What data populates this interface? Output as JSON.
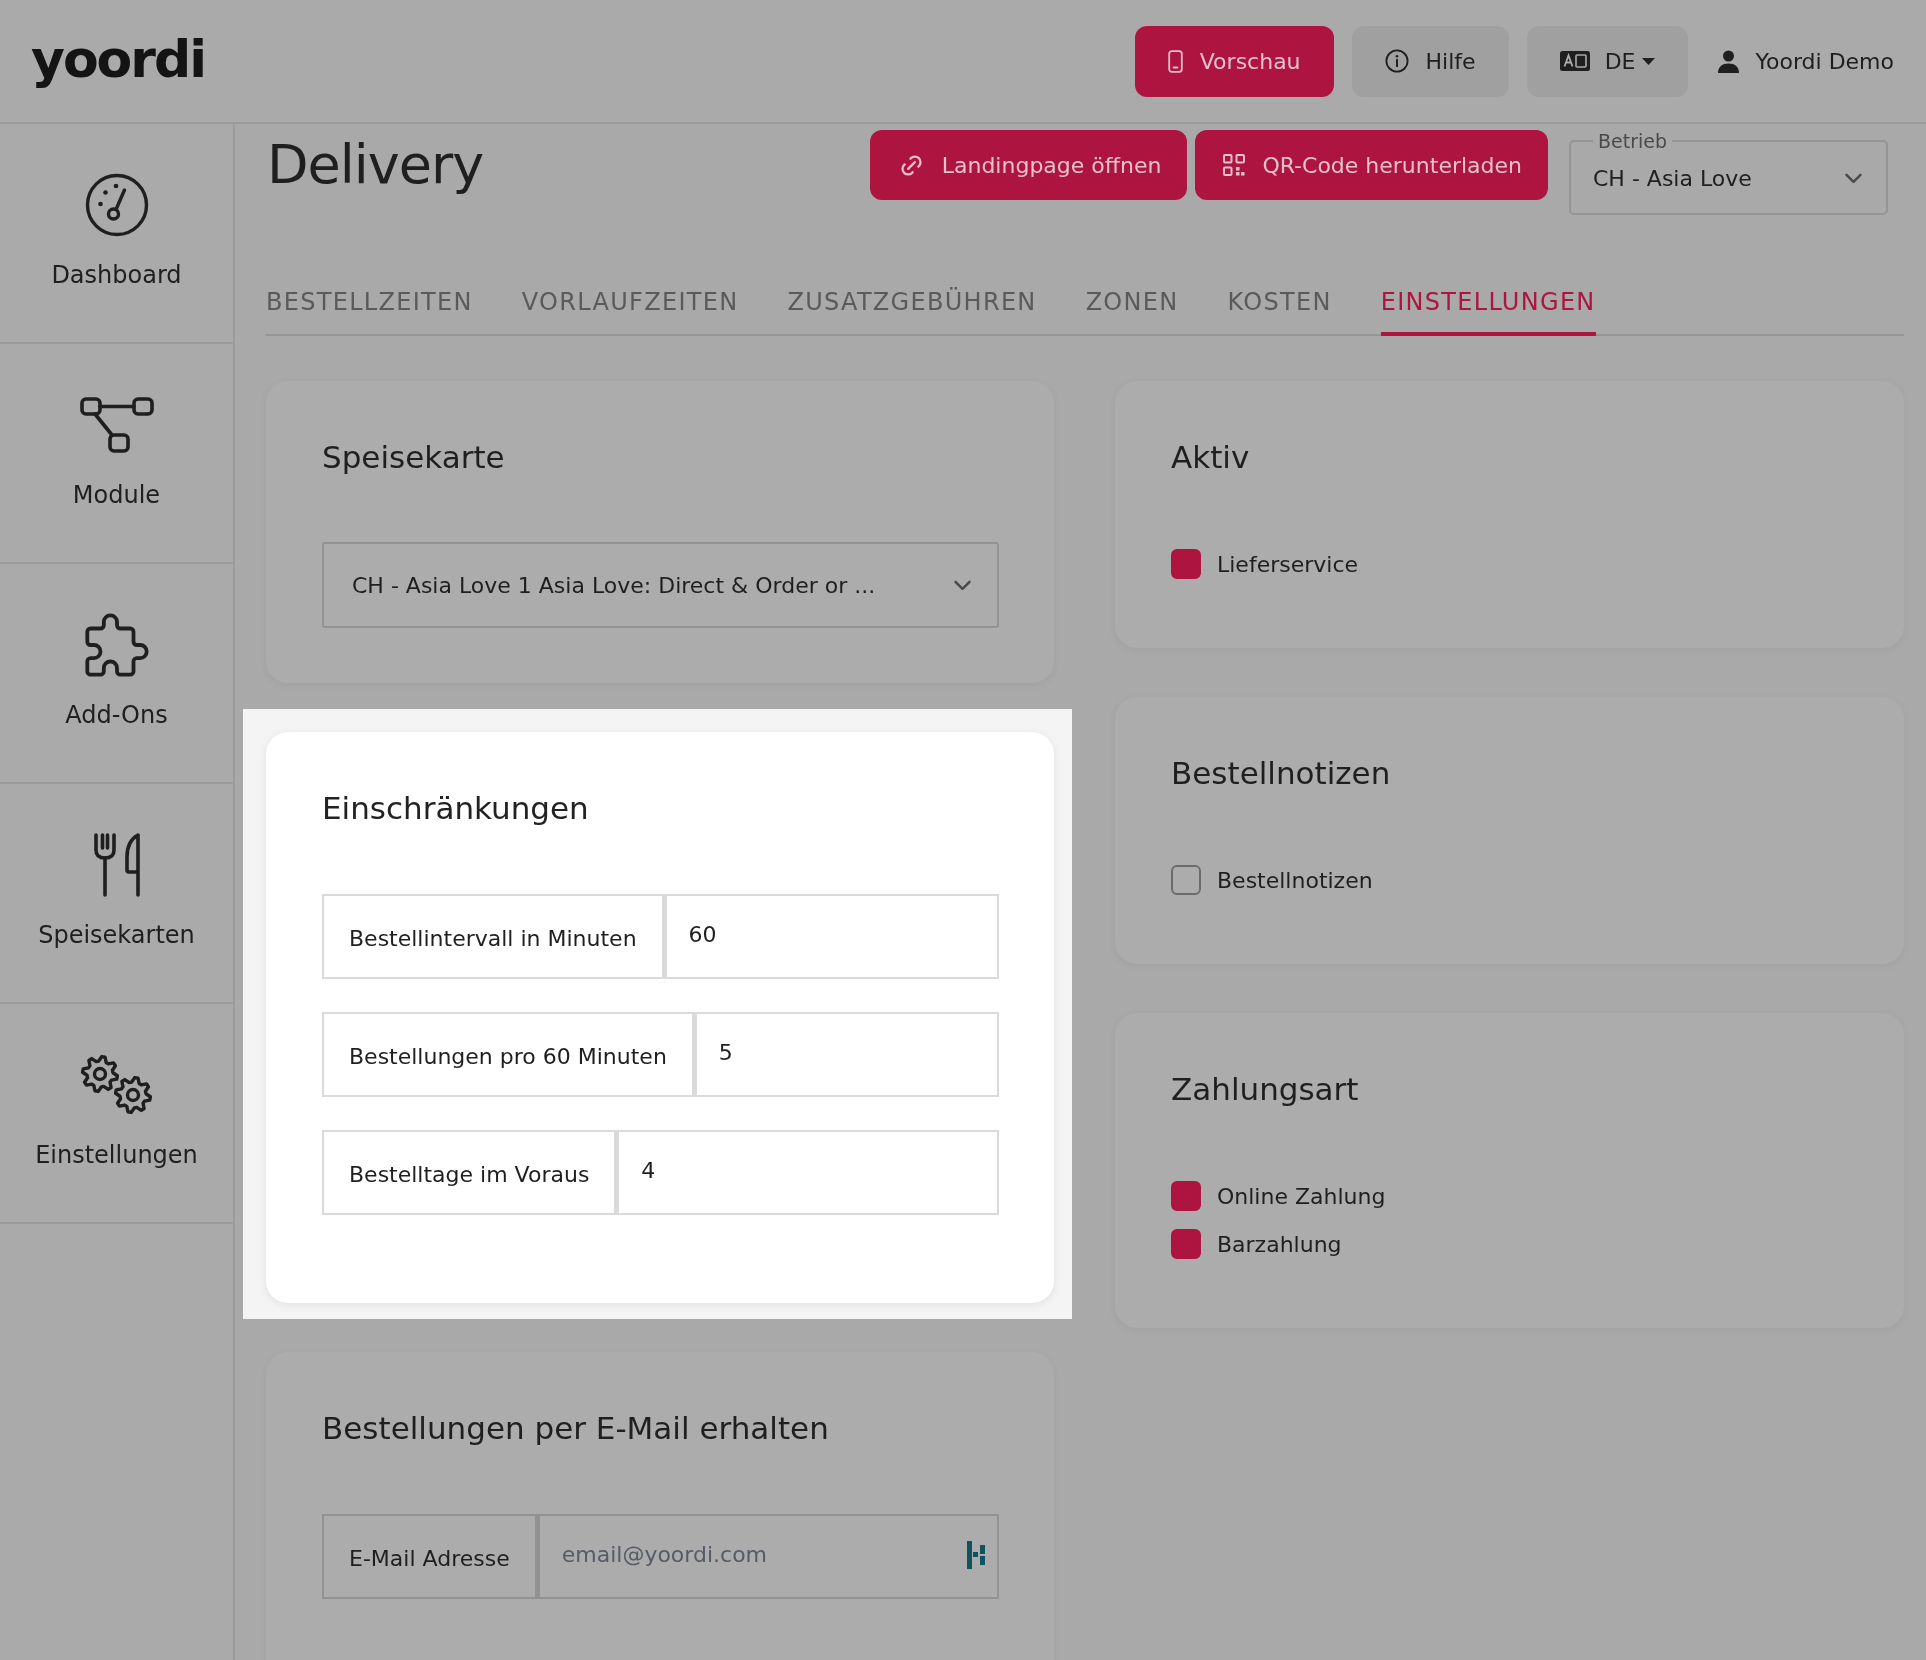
{
  "header": {
    "logo": "yoordi",
    "buttons": [
      {
        "kind": "preview",
        "label": "Vorschau"
      },
      {
        "kind": "help",
        "label": "Hilfe"
      },
      {
        "kind": "language",
        "label": "DE"
      }
    ],
    "user": "Yoordi Demo"
  },
  "sidebar": {
    "items": [
      {
        "kind": "dashboard",
        "label": "Dashboard"
      },
      {
        "kind": "modules",
        "label": "Module"
      },
      {
        "kind": "addons",
        "label": "Add-Ons"
      },
      {
        "kind": "menus",
        "label": "Speisekarten"
      },
      {
        "kind": "settings",
        "label": "Einstellungen"
      }
    ]
  },
  "page": {
    "title": "Delivery",
    "actions": [
      {
        "kind": "link",
        "label": "Landingpage öffnen"
      },
      {
        "kind": "qr",
        "label": "QR-Code herunterladen"
      }
    ],
    "location_select": {
      "label": "Betrieb",
      "value": "CH - Asia Love"
    }
  },
  "tabs": [
    {
      "label": "BESTELLZEITEN",
      "selected": false
    },
    {
      "label": "VORLAUFZEITEN",
      "selected": false
    },
    {
      "label": "ZUSATZGEBÜHREN",
      "selected": false
    },
    {
      "label": "ZONEN",
      "selected": false
    },
    {
      "label": "KOSTEN",
      "selected": false
    },
    {
      "label": "EINSTELLUNGEN",
      "selected": true
    }
  ],
  "left_column": {
    "cards": [
      {
        "kind": "select",
        "title": "Speisekarte",
        "highlighted": false,
        "value": "CH - Asia Love 1 Asia Love: Direct & Order or ..."
      },
      {
        "kind": "inputs",
        "title": "Einschränkungen",
        "highlighted": true,
        "fields": [
          {
            "kind": "number",
            "label": "Bestellintervall in Minuten",
            "value": "60"
          },
          {
            "kind": "number",
            "label": "Bestellungen pro 60 Minuten",
            "value": "5"
          },
          {
            "kind": "number",
            "label": "Bestelltage im Voraus",
            "value": "4"
          }
        ]
      },
      {
        "kind": "inputs",
        "title": "Bestellungen per E-Mail erhalten",
        "highlighted": false,
        "fields": [
          {
            "kind": "email",
            "label": "E-Mail Adresse",
            "placeholder": "email@yoordi.com"
          }
        ]
      }
    ]
  },
  "right_column": {
    "cards": [
      {
        "kind": "checks",
        "title": "Aktiv",
        "highlighted": false,
        "options": [
          {
            "label": "Lieferservice",
            "checked": true
          }
        ]
      },
      {
        "kind": "checks",
        "title": "Bestellnotizen",
        "highlighted": false,
        "options": [
          {
            "label": "Bestellnotizen",
            "checked": false
          }
        ]
      },
      {
        "kind": "checks",
        "title": "Zahlungsart",
        "highlighted": false,
        "options": [
          {
            "label": "Online Zahlung",
            "checked": true
          },
          {
            "label": "Barzahlung",
            "checked": true
          }
        ]
      }
    ]
  }
}
